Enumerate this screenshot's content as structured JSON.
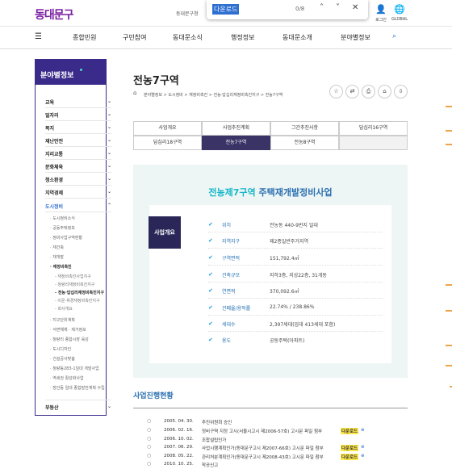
{
  "topbar": {
    "logo": "동대문구",
    "note": "동대문구청",
    "find_query": "다운로드",
    "find_count": "0/8",
    "up_icon": "˄",
    "down_icon": "˅",
    "close_icon": "✕",
    "login_label": "로그인",
    "global_label": "GLOBAL"
  },
  "nav": {
    "items": [
      "종합민원",
      "구민참여",
      "동대문소식",
      "행정정보",
      "동대문소개",
      "분야별정보"
    ]
  },
  "sidebar": {
    "title": "분야별정보",
    "items": [
      {
        "label": "교육",
        "chev": "⌄"
      },
      {
        "label": "일자리",
        "chev": "⌄"
      },
      {
        "label": "복지",
        "chev": "⌄"
      },
      {
        "label": "재난안전",
        "chev": "⌄"
      },
      {
        "label": "지리교통",
        "chev": "⌄"
      },
      {
        "label": "문화체육",
        "chev": "⌄"
      },
      {
        "label": "청소환경",
        "chev": "⌄"
      },
      {
        "label": "지역경제",
        "chev": "⌄"
      },
      {
        "label": "도시정비",
        "chev": "⌃"
      }
    ],
    "sub": [
      "도시정비소식",
      "공동주택정보",
      "정비사업구역현황",
      "재건축",
      "재개발",
      "재정비촉진"
    ],
    "sub2": [
      "재정비촉진사업지구",
      "청량리재정비촉진지구",
      "전농·답십리재정비촉진지구",
      "이문·휘경재정비촉진지구",
      "회사개요"
    ],
    "sub_after": [
      "지구단위계획",
      "석면해체 · 제거정보",
      "청량리 종합시장 육성",
      "도시디자인",
      "건설공사맞춤",
      "청량동283-1일대 개발사업",
      "역세권 활성화사업",
      "장안동 일대 종합발전계획 수립"
    ],
    "last": "부동산",
    "last_chev": "⌄"
  },
  "main": {
    "title": "전농7구역",
    "breadcrumb": "분야별정보 > 도시정비 > 재정비촉진 > 전농·답십리재정비촉진지구 > 전농7구역",
    "tools": [
      "☆",
      "⇄",
      "⎙",
      "⌂",
      "⇩"
    ],
    "tabs_row1": [
      "사업개요",
      "사업추진계획",
      "그간추진사항",
      "답십리16구역"
    ],
    "tabs_row2": [
      "답십리18구역",
      "전농7구역",
      "전농8구역",
      ""
    ],
    "overview": {
      "title_hl": "전농제7구역",
      "title_rest": "주택재개발정비사업",
      "badge": "사업개요",
      "rows": [
        {
          "k": "위치",
          "v": "전농동 440-9번지 일대"
        },
        {
          "k": "지역지구",
          "v": "제2종일반주거지역"
        },
        {
          "k": "구역면적",
          "v": "151,792.4㎡"
        },
        {
          "k": "건축규모",
          "v": "지하3층, 지상22층, 31개동"
        },
        {
          "k": "연면적",
          "v": "370,092.6㎡"
        },
        {
          "k": "건폐율/용적률",
          "v": "22.74% / 238.86%"
        },
        {
          "k": "세대수",
          "v": "2,397세대(임대 413세대 포함)"
        },
        {
          "k": "용도",
          "v": "공동주택(아파트)"
        }
      ]
    },
    "history_title": "사업진행현황",
    "history": [
      {
        "date": "2005. 04. 30.",
        "desc": "추진위원회 승인",
        "dl": ""
      },
      {
        "date": "2006. 02. 16.",
        "desc": "정비구역 지정 고시(서울시고시 제2006-57호) 고시문 파일 첨부",
        "dl": "다운로드"
      },
      {
        "date": "2006. 10. 02.",
        "desc": "조합설립인가",
        "dl": ""
      },
      {
        "date": "2007. 06. 29.",
        "desc": "사업시행계획인가(동대문구고시 제2007-66호) 고시문 파일 첨부",
        "dl": "다운로드"
      },
      {
        "date": "2008. 05. 22.",
        "desc": "관리처분계획인가(동대문구고시 제2008-43호) 고시문 파일 첨부",
        "dl": "다운로드"
      },
      {
        "date": "2010. 10. 25.",
        "desc": "착공신고",
        "dl": ""
      }
    ]
  }
}
